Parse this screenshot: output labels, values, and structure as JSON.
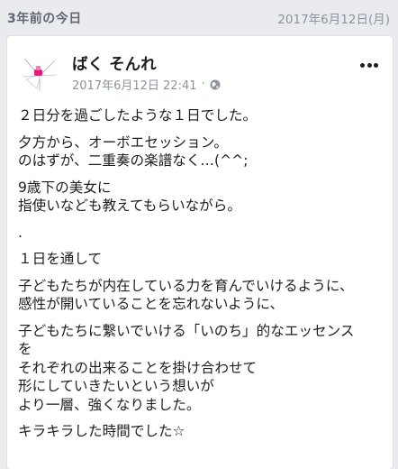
{
  "header": {
    "title": "3年前の今日",
    "date": "2017年6月12日(月)"
  },
  "post": {
    "author": "ばく そんれ",
    "timestamp": "2017年6月12日 22:41",
    "separator": "·",
    "privacy_icon": "globe-icon",
    "menu_icon": "more-icon",
    "paragraphs": [
      "２日分を過ごしたような１日でした。",
      "夕方から、オーボエセッション。\nのはずが、二重奏の楽譜なく…(^^;",
      "9歳下の美女に\n指使いなども教えてもらいながら。",
      ".",
      "１日を通して",
      "子どもたちが内在している力を育んでいけるように、\n感性が開いていることを忘れないように、",
      "子どもたちに繋いでいける「いのち」的なエッセンス\nを\nそれぞれの出来ることを掛け合わせて\n形にしていきたいという想いが\nより一層、強くなりました。",
      "キラキラした時間でした☆"
    ]
  },
  "colors": {
    "background": "#e9ebee",
    "card": "#ffffff",
    "muted_text": "#8d949e",
    "avatar_accent": "#e6177a"
  }
}
